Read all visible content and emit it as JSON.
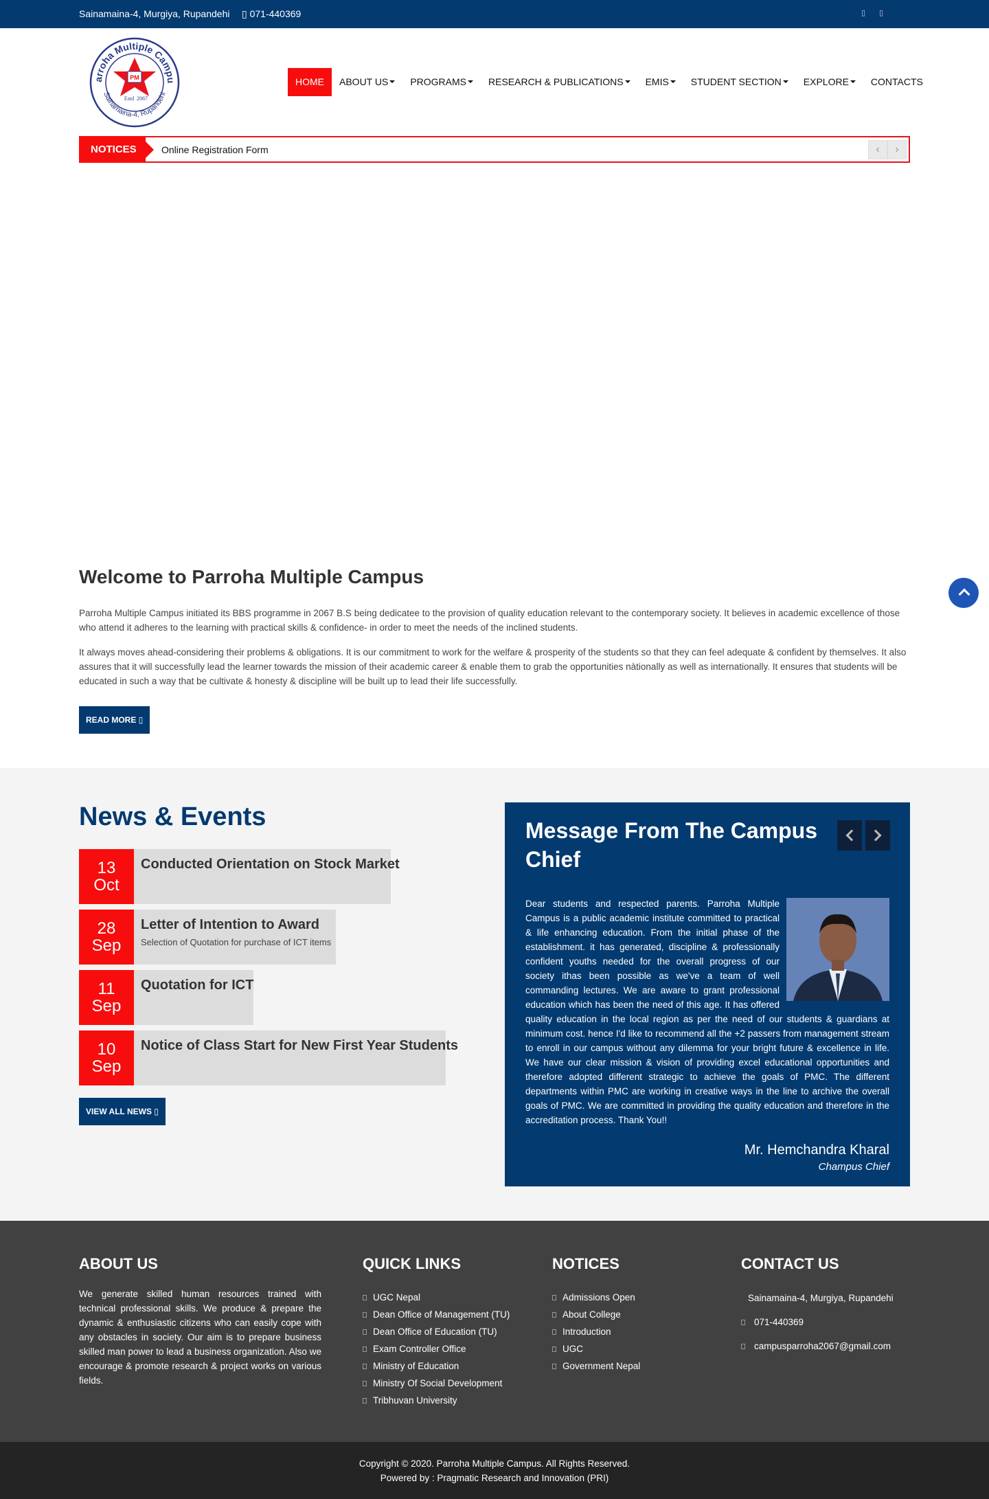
{
  "topbar": {
    "address": "Sainamaina-4, Murgiya, Rupandehi",
    "phone": "071-440369"
  },
  "logo": {
    "ring_text": "Parroha Multiple Campus",
    "bottom_text": "Sainamaina-4, Rupandehi",
    "initials": "PM",
    "estd": "Estd",
    "year": "2067"
  },
  "nav": {
    "items": [
      {
        "label": "HOME",
        "active": true,
        "dropdown": false
      },
      {
        "label": "ABOUT US",
        "dropdown": true
      },
      {
        "label": "PROGRAMS",
        "dropdown": true
      },
      {
        "label": "RESEARCH & PUBLICATIONS",
        "dropdown": true
      },
      {
        "label": "EMIS",
        "dropdown": true
      },
      {
        "label": "STUDENT SECTION",
        "dropdown": true
      },
      {
        "label": "EXPLORE",
        "dropdown": true
      },
      {
        "label": "CONTACTS",
        "dropdown": false
      }
    ]
  },
  "notices": {
    "tag": "NOTICES",
    "text": "Online Registration Form"
  },
  "welcome": {
    "title": "Welcome to Parroha Multiple Campus",
    "p1": "Parroha Multiple Campus initiated its BBS programme in 2067 B.S being dedicatee to the provision of quality education relevant to the contemporary society. It believes in academic excellence of those who attend it adheres to the learning with practical skills & confidence- in order to meet the needs of the inclined students.",
    "p2": "It always moves ahead-considering their problems & obligations. It is our commitment to work for the welfare & prosperity of the students so that they can feel adequate & confident by themselves. It also assures that it will successfully lead the learner towards the mission of their academic career & enable them to grab the opportunities nàtionally as well as internationally. It ensures that students will be educated in such a way that be cultivate & honesty & discipline will be built up to lead their life successfully.",
    "read_more": "READ MORE"
  },
  "news": {
    "title": "News & Events",
    "items": [
      {
        "day": "13",
        "month": "Oct",
        "title": "Conducted Orientation on Stock Market",
        "sub": ""
      },
      {
        "day": "28",
        "month": "Sep",
        "title": "Letter of Intention to Award",
        "sub": "Selection of Quotation for purchase of ICT items"
      },
      {
        "day": "11",
        "month": "Sep",
        "title": "Quotation for ICT",
        "sub": ""
      },
      {
        "day": "10",
        "month": "Sep",
        "title": "Notice of Class Start for New First Year Students",
        "sub": ""
      }
    ],
    "view_all": "VIEW ALL NEWS"
  },
  "message": {
    "title": "Message From The Campus Chief",
    "body": "Dear students and respected parents. Parroha Multiple Campus is a public academic institute committed to practical & life enhancing education. From the initial phase of the establishment. it has generated, discipline & professionally confident youths needed for the overall progress of our society ithas been possible as we've a team of well commanding lectures. We are aware to grant professional education which has been the need of this age. It has offered quality education in the local region as per the need of our students & guardians at minimum cost. hence I'd like to recommend all the +2 passers from management stream to enroll in our campus without any dilemma for your bright future & excellence in life. We have our clear mission & vision of providing excel educational opportunities and therefore adopted different strategic to achieve the goals of PMC. The different departments within PMC are working in creative ways in the line to archive the overall goals of PMC. We are committed in providing the quality education and therefore in the accreditation process. Thank You!!",
    "name": "Mr. Hemchandra Kharal",
    "role": "Champus Chief"
  },
  "footer": {
    "about_title": "ABOUT US",
    "about_text": "We generate skilled human resources trained with technical professional skills. We produce & prepare the dynamic & enthusiastic citizens who can easily cope with any obstacles in society. Our aim is to prepare business skilled man power to lead a business organization. Also we encourage & promote research & project works on various fields.",
    "links_title": "QUICK LINKS",
    "links": [
      "UGC Nepal",
      "Dean Office of Management (TU)",
      "Dean Office of Education (TU)",
      "Exam Controller Office",
      "Ministry of Education",
      "Ministry Of Social Development",
      "Tribhuvan University"
    ],
    "notices_title": "NOTICES",
    "notices": [
      "Admissions Open",
      "About College",
      "Introduction",
      "UGC",
      "Government Nepal"
    ],
    "contact_title": "CONTACT US",
    "contact_address": "Sainamaina-4, Murgiya, Rupandehi",
    "contact_phone": "071-440369",
    "contact_email": "campusparroha2067@gmail.com"
  },
  "copyright": {
    "line1": "Copyright © 2020. Parroha Multiple Campus. All Rights Reserved.",
    "line2": "Powered by : Pragmatic Research and Innovation (PRI)"
  },
  "colors": {
    "primary": "#033a70",
    "accent": "#f70d0d",
    "footer": "#414141",
    "bottom": "#242424"
  }
}
